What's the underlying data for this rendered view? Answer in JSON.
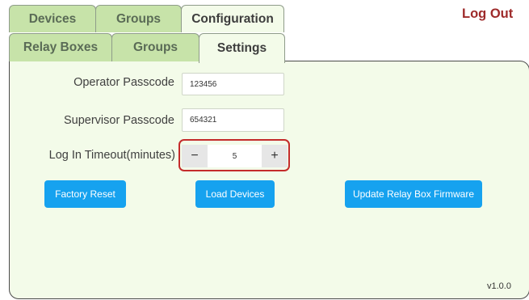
{
  "top_tabs": [
    {
      "label": "Devices",
      "active": false
    },
    {
      "label": "Groups",
      "active": false
    },
    {
      "label": "Configuration",
      "active": true
    }
  ],
  "sub_tabs": [
    {
      "label": "Relay Boxes",
      "active": false
    },
    {
      "label": "Groups",
      "active": false
    },
    {
      "label": "Settings",
      "active": true
    }
  ],
  "logout_label": "Log Out",
  "settings": {
    "operator_passcode": {
      "label": "Operator Passcode",
      "value": "123456"
    },
    "supervisor_passcode": {
      "label": "Supervisor Passcode",
      "value": "654321"
    },
    "timeout": {
      "label": "Log In Timeout(minutes)",
      "value": "5",
      "decrement": "−",
      "increment": "+"
    }
  },
  "buttons": {
    "factory_reset": "Factory Reset",
    "load_devices": "Load Devices",
    "update_firmware": "Update Relay Box Firmware"
  },
  "version": "v1.0.0",
  "colors": {
    "tab_inactive": "#c7e3a9",
    "tab_active": "#f3fbe9",
    "logout": "#9e2b2b",
    "button": "#16a2ef",
    "highlight_border": "#c42b2b"
  }
}
